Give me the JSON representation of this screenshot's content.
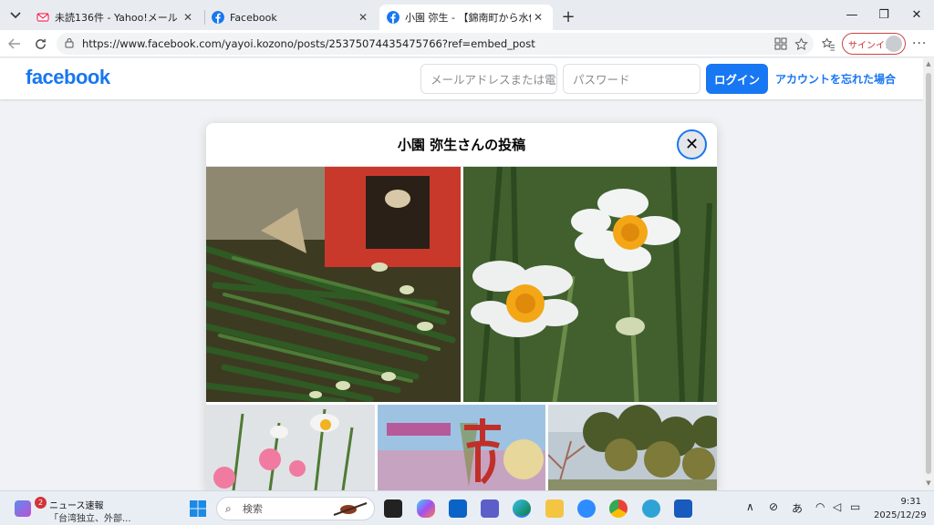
{
  "browser": {
    "tabs": [
      {
        "title": "未読136件 - Yahoo!メール",
        "favicon_color": "#ff0033"
      },
      {
        "title": "Facebook",
        "favicon_color": "#1877f2"
      },
      {
        "title": "小園 弥生 - 【錦南町から水仙便だよ",
        "favicon_color": "#1877f2"
      }
    ],
    "url": "https://www.facebook.com/yayoi.kozono/posts/25375074435475766?ref=embed_post",
    "signin_label": "サインイン",
    "new_tab": "+",
    "win_min": "—",
    "win_restore": "❐",
    "win_close": "✕"
  },
  "facebook": {
    "logo": "facebook",
    "email_placeholder": "メールアドレスまたは電",
    "password_placeholder": "パスワード",
    "login_label": "ログイン",
    "forgot_label": "アカウントを忘れた場合",
    "brand_color": "#1877f2"
  },
  "modal": {
    "title": "小園 弥生さんの投稿",
    "close": "✕"
  },
  "taskbar": {
    "news_badge": "2",
    "news_title": "ニュース速報",
    "news_sub": "「台湾独立、外部...",
    "search_label": "検索",
    "ime": "あ",
    "time": "9:31",
    "date": "2025/12/29"
  }
}
